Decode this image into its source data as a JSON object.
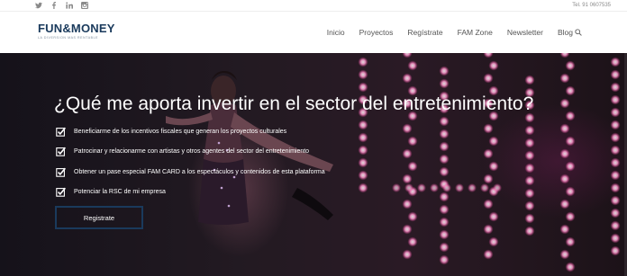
{
  "topbar": {
    "social": [
      "twitter-icon",
      "facebook-icon",
      "linkedin-icon",
      "instagram-icon"
    ],
    "phone": "Tel. 91 0607535"
  },
  "header": {
    "logo": {
      "main_left": "FUN",
      "amp": "&",
      "main_right": "MONEY",
      "tagline": "LA DIVERSION MAS RENTABLE"
    },
    "nav": [
      "Inicio",
      "Proyectos",
      "Regístrate",
      "FAM Zone",
      "Newsletter",
      "Blog"
    ],
    "search_icon": "search-icon"
  },
  "hero": {
    "title": "¿Qué me aporta invertir en el sector del entretenimiento?",
    "bullets": [
      "Beneficiarme de los incentivos fiscales que generan los proyectos culturales",
      "Patrocinar y relacionarme con artistas y otros agentes del sector del entretenimiento",
      "Obtener un pase especial FAM CARD a los espectáculos y contenidos de esta plataforma",
      "Potenciar la RSC de mi empresa"
    ],
    "cta_label": "Registrate"
  },
  "colors": {
    "brand": "#1a3a5c",
    "check": "#ffffff"
  }
}
